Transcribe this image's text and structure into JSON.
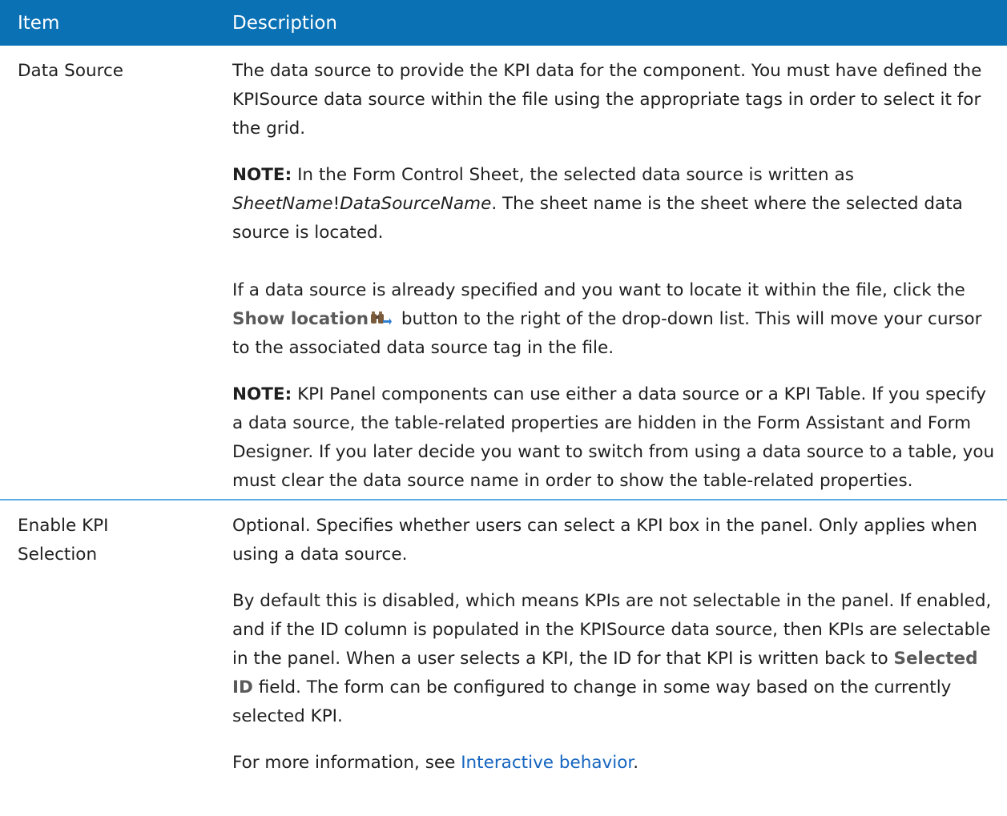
{
  "table": {
    "header": {
      "item": "Item",
      "description": "Description"
    },
    "rows": [
      {
        "item": "Data Source",
        "p1": "The data source to provide the KPI data for the component. You must have defined the KPISource data source within the file using the appropriate tags in order to select it for the grid.",
        "note1": {
          "label": "NOTE:",
          "text_a": " In the Form Control Sheet, the selected data source is written as ",
          "italic_a": "SheetName",
          "bang": "!",
          "italic_b": "DataSourceName",
          "text_b": ". The sheet name is the sheet where the selected data source is located."
        },
        "p3": {
          "text_a": "If a data source is already specified and you want to locate it within the file, click the ",
          "ui_term": "Show location",
          "icon": "binoculars-icon",
          "text_b": " button to the right of the drop-down list. This will move your cursor to the associated data source tag in the file."
        },
        "note2": {
          "label": "NOTE:",
          "text": " KPI Panel components can use either a data source or a KPI Table. If you specify a data source, the table-related properties are hidden in the Form Assistant and Form Designer. If you later decide you want to switch from using a data source to a table, you must clear the data source name in order to show the table-related properties."
        }
      },
      {
        "item": "Enable KPI Selection",
        "p1": "Optional. Specifies whether users can select a KPI box in the panel. Only applies when using a data source.",
        "p2": {
          "text_a": "By default this is disabled, which means KPIs are not selectable in the panel. If enabled, and if the ID column is populated in the KPISource data source, then KPIs are selectable in the panel. When a user selects a KPI, the ID for that KPI is written back to ",
          "ui_term": "Selected ID",
          "text_b": " field. The form can be configured to change in some way based on the currently selected KPI."
        },
        "p3": {
          "text_a": "For more information, see ",
          "link": "Interactive behavior",
          "text_b": "."
        }
      }
    ]
  },
  "colors": {
    "header_bg": "#0a71b5",
    "separator": "#5aaee0",
    "link": "#1565c0"
  }
}
